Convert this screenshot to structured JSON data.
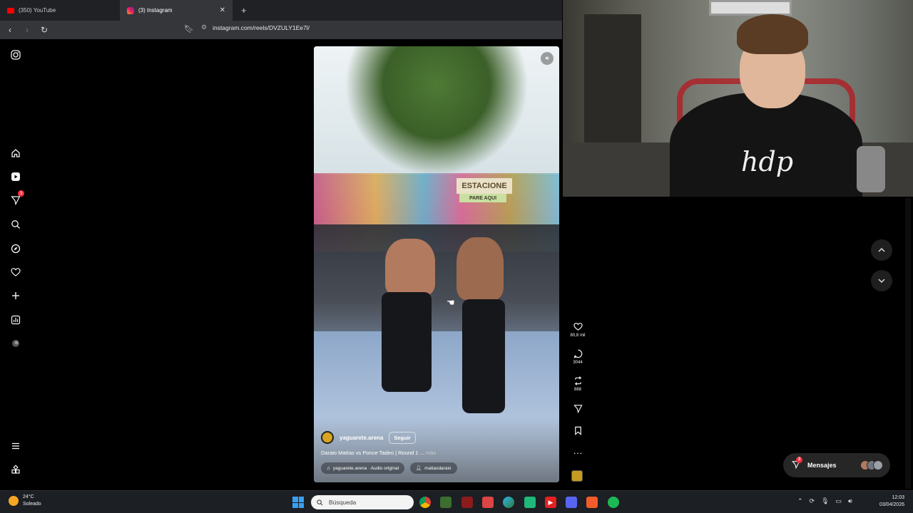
{
  "browser": {
    "tabs": [
      {
        "label": "(350) YouTube",
        "icon": "youtube-icon",
        "active": false
      },
      {
        "label": "(3) Instagram",
        "icon": "instagram-icon",
        "active": true
      }
    ],
    "url": "instagram.com/reels/DVZULY1Ee7l/"
  },
  "sidebar": {
    "notification_count": "3"
  },
  "reel": {
    "username": "yaguarete.arena",
    "follow_label": "Seguir",
    "caption": "Daraio Matías vs Ponce Tadeo | Round 1 ...",
    "caption_more": "más",
    "audio": "yaguarete.arena · Audio original",
    "tagged_user": "matiasdaraio",
    "sign_text": "ESTACIONE",
    "sign_subtext": "PARE AQUI",
    "likes": "80,8 mil",
    "comments": "3044",
    "reposts": "888"
  },
  "webcam": {
    "shirt_logo": "hdp"
  },
  "messages": {
    "label": "Mensajes",
    "badge": "3"
  },
  "taskbar": {
    "temperature": "24°C",
    "weather": "Soleado",
    "search_placeholder": "Búsqueda",
    "time": "12:03",
    "date": "03/04/2026"
  },
  "colors": {
    "instagram_badge": "#ff3040",
    "taskbar_bg": "#1c1f24",
    "browser_tab_active": "#35363a"
  }
}
